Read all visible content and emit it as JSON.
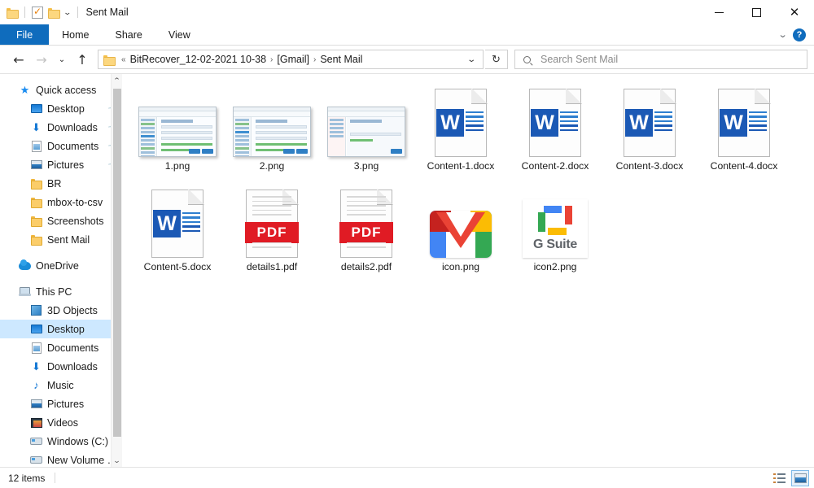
{
  "window": {
    "title": "Sent Mail",
    "quick_access_icons": [
      "folder-icon",
      "properties-icon",
      "new-folder-icon",
      "customize-chevron-icon"
    ],
    "controls": {
      "minimize": "minimize-button",
      "maximize": "maximize-button",
      "close": "close-button"
    }
  },
  "ribbon": {
    "tabs": [
      {
        "label": "File",
        "active": true
      },
      {
        "label": "Home",
        "active": false
      },
      {
        "label": "Share",
        "active": false
      },
      {
        "label": "View",
        "active": false
      }
    ],
    "collapse_icon": "chevron-down-icon",
    "help_label": "?"
  },
  "address": {
    "back_icon": "back-arrow-icon",
    "forward_icon": "forward-arrow-icon",
    "recent_icon": "chevron-down-icon",
    "up_icon": "up-arrow-icon",
    "overflow": "«",
    "crumbs": [
      "BitRecover_12-02-2021 10-38",
      "[Gmail]",
      "Sent Mail"
    ],
    "separator": "›",
    "dropdown_icon": "chevron-down-icon",
    "refresh_icon": "↻"
  },
  "search": {
    "placeholder": "Search Sent Mail",
    "icon": "search-icon"
  },
  "sidebar": {
    "groups": [
      {
        "header": {
          "label": "Quick access",
          "icon": "star-icon"
        },
        "items": [
          {
            "label": "Desktop",
            "icon": "desktop-icon",
            "pinned": true
          },
          {
            "label": "Downloads",
            "icon": "downloads-icon",
            "pinned": true
          },
          {
            "label": "Documents",
            "icon": "documents-icon",
            "pinned": true
          },
          {
            "label": "Pictures",
            "icon": "pictures-icon",
            "pinned": true
          },
          {
            "label": "BR",
            "icon": "folder-icon",
            "pinned": false
          },
          {
            "label": "mbox-to-csv",
            "icon": "folder-icon",
            "pinned": false
          },
          {
            "label": "Screenshots",
            "icon": "folder-icon",
            "pinned": false
          },
          {
            "label": "Sent Mail",
            "icon": "folder-icon",
            "pinned": false
          }
        ]
      },
      {
        "header": {
          "label": "OneDrive",
          "icon": "onedrive-icon"
        },
        "items": []
      },
      {
        "header": {
          "label": "This PC",
          "icon": "this-pc-icon"
        },
        "items": [
          {
            "label": "3D Objects",
            "icon": "3d-objects-icon",
            "selected": false
          },
          {
            "label": "Desktop",
            "icon": "desktop-icon",
            "selected": true
          },
          {
            "label": "Documents",
            "icon": "documents-icon",
            "selected": false
          },
          {
            "label": "Downloads",
            "icon": "downloads-icon",
            "selected": false
          },
          {
            "label": "Music",
            "icon": "music-icon",
            "selected": false
          },
          {
            "label": "Pictures",
            "icon": "pictures-icon",
            "selected": false
          },
          {
            "label": "Videos",
            "icon": "videos-icon",
            "selected": false
          },
          {
            "label": "Windows (C:)",
            "icon": "drive-icon",
            "selected": false
          },
          {
            "label": "New Volume (D:)",
            "icon": "drive-icon",
            "selected": false
          }
        ]
      }
    ],
    "pin_icon": "pin-icon",
    "scroll_up_icon": "chevron-up-icon",
    "scroll_down_icon": "chevron-down-icon"
  },
  "files": [
    {
      "name": "1.png",
      "type": "image-screenshot",
      "variant": 1
    },
    {
      "name": "2.png",
      "type": "image-screenshot",
      "variant": 2
    },
    {
      "name": "3.png",
      "type": "image-screenshot",
      "variant": 3
    },
    {
      "name": "Content-1.docx",
      "type": "docx",
      "glyph": "W"
    },
    {
      "name": "Content-2.docx",
      "type": "docx",
      "glyph": "W"
    },
    {
      "name": "Content-3.docx",
      "type": "docx",
      "glyph": "W"
    },
    {
      "name": "Content-4.docx",
      "type": "docx",
      "glyph": "W"
    },
    {
      "name": "Content-5.docx",
      "type": "docx",
      "glyph": "W"
    },
    {
      "name": "details1.pdf",
      "type": "pdf",
      "glyph": "PDF"
    },
    {
      "name": "details2.pdf",
      "type": "pdf",
      "glyph": "PDF"
    },
    {
      "name": "icon.png",
      "type": "gmail-logo"
    },
    {
      "name": "icon2.png",
      "type": "gsuite-logo",
      "glyph": "G Suite"
    }
  ],
  "status": {
    "item_count": "12 items",
    "view_details_icon": "details-view-icon",
    "view_large_icons_icon": "large-icons-view-icon",
    "active_view": "large-icons"
  },
  "colors": {
    "accent_blue": "#0f6cbd",
    "selection_blue": "#cde8ff",
    "word_blue": "#1b59b5",
    "pdf_red": "#e01b24"
  }
}
